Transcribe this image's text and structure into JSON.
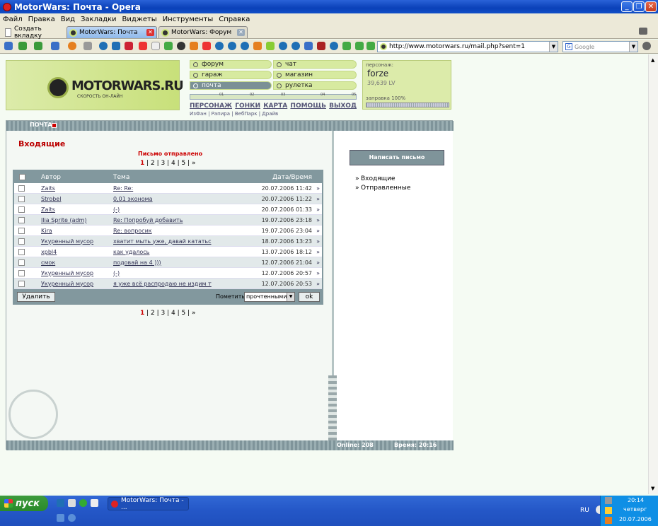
{
  "window": {
    "title": "MotorWars: Почта - Opera"
  },
  "menu": [
    "Файл",
    "Правка",
    "Вид",
    "Закладки",
    "Виджеты",
    "Инструменты",
    "Справка"
  ],
  "tabs": [
    {
      "label": "Создать вкладку"
    },
    {
      "label": "MotorWars: Почта"
    },
    {
      "label": "MotorWars: Форум"
    }
  ],
  "address": {
    "url": "http://www.motorwars.ru/mail.php?sent=1"
  },
  "search": {
    "placeholder": "Google"
  },
  "site": {
    "logo": "MOTORWARS.RU",
    "slogan": "СКОРОСТЬ ОН-ЛАЙН",
    "nav_left": [
      "форум",
      "гараж",
      "почта"
    ],
    "nav_right": [
      "чат",
      "магазин",
      "рулетка"
    ],
    "gauge_ticks": [
      "01",
      "02",
      "03",
      "04",
      "05"
    ],
    "top_links": [
      "ПЕРСОНАЖ",
      "ГОНКИ",
      "КАРТА",
      "ПОМОЩЬ",
      "ВЫХОД"
    ],
    "sub_links": "ИзФан | Рапира | ВебПарк | Драйв",
    "persona": {
      "label": "персонаж:",
      "name": "forze",
      "lv": "39,639 LV",
      "fuel": "заправка 100%",
      "fuel_level": 1.0
    }
  },
  "mail": {
    "section": "ПОЧТА",
    "title": "Входящие",
    "sent_notice": "Письмо отправлено",
    "pager": {
      "pages": [
        "1",
        "2",
        "3",
        "4",
        "5"
      ],
      "next": "»",
      "current": "1"
    },
    "columns": {
      "author": "Автор",
      "subject": "Тема",
      "date": "Дата/Время"
    },
    "rows": [
      {
        "author": "Zaits",
        "subject": "Re: Re:",
        "date": "20.07.2006 11:42"
      },
      {
        "author": "Strobel",
        "subject": "0,01 эконома",
        "date": "20.07.2006 11:22"
      },
      {
        "author": "Zaits",
        "subject": "(-)",
        "date": "20.07.2006 01:33"
      },
      {
        "author": "Ilia Sprite (adm)",
        "subject": "Re: Попробуй добавить",
        "date": "19.07.2006 23:18"
      },
      {
        "author": "Kira",
        "subject": "Re: вопросик",
        "date": "19.07.2006 23:04"
      },
      {
        "author": "Укуренный мусор",
        "subject": "хватит мыть уже, давай кататьс",
        "date": "18.07.2006 13:23"
      },
      {
        "author": "xpbl4",
        "subject": "как удалось",
        "date": "13.07.2006 18:12"
      },
      {
        "author": "смок",
        "subject": "подовай на 4 )))",
        "date": "12.07.2006 21:04"
      },
      {
        "author": "Укуренный мусор",
        "subject": "(-)",
        "date": "12.07.2006 20:57"
      },
      {
        "author": "Укуренный мусор",
        "subject": "я уже всё распродаю не издим т",
        "date": "12.07.2006 20:53"
      }
    ],
    "delete_label": "Удалить",
    "mark_label": "Пометить",
    "mark_value": "прочтенными",
    "ok_label": "ok",
    "compose_label": "Написать письмо",
    "folders": [
      "Входящие",
      "Отправленные"
    ],
    "online": "Online: 208",
    "time": "Время: 20:16"
  },
  "taskbar": {
    "start": "пуск",
    "task": "MotorWars: Почта - ...",
    "lang": "RU",
    "clock": "20:14",
    "day": "четверг",
    "date": "20.07.2006"
  }
}
